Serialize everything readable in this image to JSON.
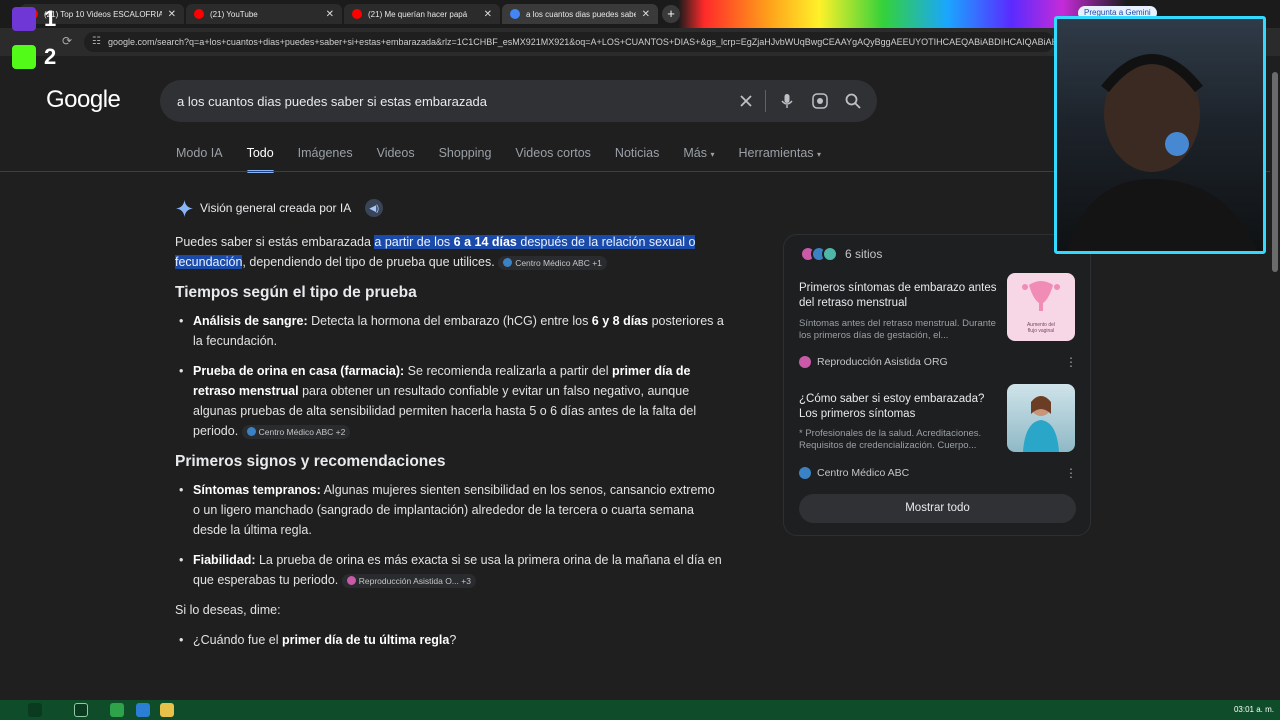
{
  "browser": {
    "tabs": [
      {
        "title": "(21) Top 10 Videos ESCALOFRIA",
        "color": "#ff0000"
      },
      {
        "title": "(21) YouTube",
        "color": "#ff0000"
      },
      {
        "title": "(21) Me querían hacer papá",
        "color": "#ff0000"
      },
      {
        "title": "a los cuantos dias puedes sabe",
        "color": "#4285f4"
      }
    ],
    "new_tab": "+",
    "url": "google.com/search?q=a+los+cuantos+dias+puedes+saber+si+estas+embarazada&rlz=1C1CHBF_esMX921MX921&oq=A+LOS+CUANTOS+DIAS+&gs_lcrp=EgZjaHJvbWUqBwgCEAAYgAQyBggAEEUYOTIHCAEQABiABDIHCAIQABiABDIHCAMQ"
  },
  "overlay": {
    "badge1": "1",
    "badge2": "2",
    "gemini": "Pregunta a Gemini"
  },
  "google": {
    "logo": "Google",
    "query": "a los cuantos dias puedes saber si estas embarazada",
    "tabs": [
      "Modo IA",
      "Todo",
      "Imágenes",
      "Videos",
      "Shopping",
      "Videos cortos",
      "Noticias",
      "Más",
      "Herramientas"
    ]
  },
  "ai": {
    "header": "Visión general creada por IA",
    "intro_pre": "Puedes saber si estás embarazada ",
    "intro_hl1": "a partir de los ",
    "intro_hl_bold": "6 a 14 días",
    "intro_hl2": " después de la relación sexual o fecundación",
    "intro_post": ", dependiendo del tipo de prueba que utilices.",
    "intro_cite": "Centro Médico ABC +1",
    "h1": "Tiempos según el tipo de prueba",
    "b1_label": "Análisis de sangre:",
    "b1_text": " Detecta la hormona del embarazo (hCG) entre los ",
    "b1_bold": "6 y 8 días",
    "b1_text2": " posteriores a la fecundación.",
    "b2_label": "Prueba de orina en casa (farmacia):",
    "b2_text": " Se recomienda realizarla a partir del ",
    "b2_bold": "primer día de retraso menstrual",
    "b2_text2": " para obtener un resultado confiable y evitar un falso negativo, aunque algunas pruebas de alta sensibilidad permiten hacerla hasta 5 o 6 días antes de la falta del periodo.",
    "b2_cite": "Centro Médico ABC +2",
    "h2": "Primeros signos y recomendaciones",
    "b3_label": "Síntomas tempranos:",
    "b3_text": " Algunas mujeres sienten sensibilidad en los senos, cansancio extremo o un ligero manchado (sangrado de implantación) alrededor de la tercera o cuarta semana desde la última regla.",
    "b4_label": "Fiabilidad:",
    "b4_text": " La prueba de orina es más exacta si se usa la primera orina de la mañana el día en que esperabas tu periodo.",
    "b4_cite": "Reproducción Asistida O... +3",
    "dime": "Si lo deseas, dime:",
    "q1_pre": "¿Cuándo fue el ",
    "q1_bold": "primer día de tu última regla",
    "q1_post": "?"
  },
  "panel": {
    "sites": "6 sitios",
    "card1": {
      "title": "Primeros síntomas de embarazo antes del retraso menstrual",
      "snippet": "Síntomas antes del retraso menstrual. Durante los primeros días de gestación, el...",
      "source": "Reproducción Asistida ORG",
      "thumb_caption": "Aumento del flujo vaginal"
    },
    "card2": {
      "title": "¿Cómo saber si estoy embarazada? Los primeros síntomas",
      "snippet": "* Profesionales de la salud. Acreditaciones. Requisitos de credencialización. Cuerpo...",
      "source": "Centro Médico ABC"
    },
    "show_all": "Mostrar todo"
  },
  "taskbar": {
    "clock": "03:01 a. m."
  }
}
